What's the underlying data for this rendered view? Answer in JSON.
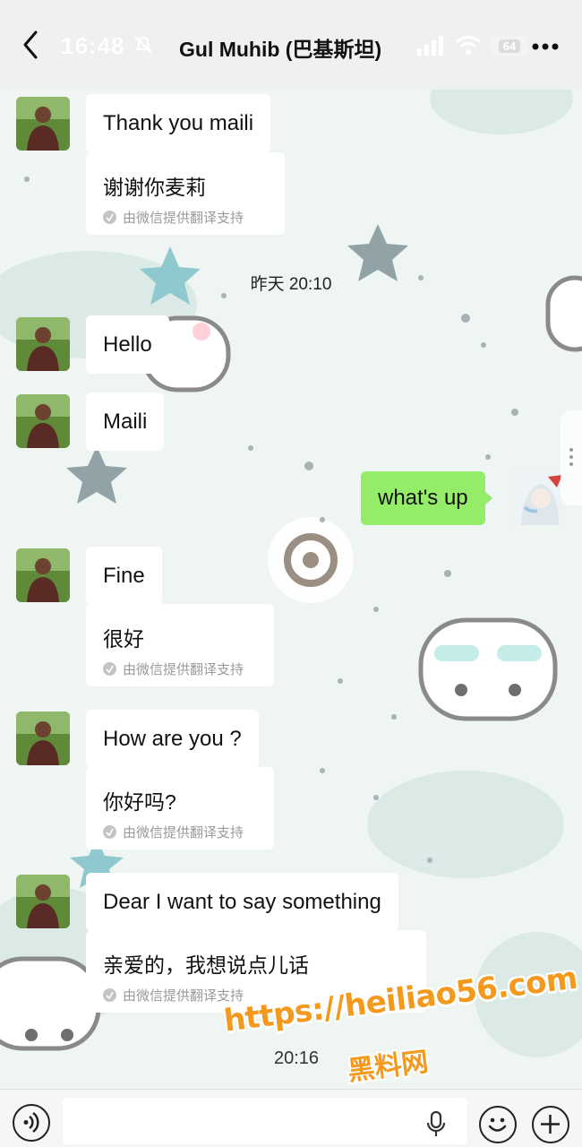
{
  "status_bar": {
    "time": "16:48",
    "battery": "64"
  },
  "header": {
    "title": "Gul Muhib (巴基斯坦)",
    "back_icon": "chevron-left-icon",
    "more_icon": "more-dots-icon"
  },
  "messages": [
    {
      "sender": "contact",
      "text": "Thank you maili",
      "translation": "谢谢你麦莉",
      "translation_source": "由微信提供翻译支持"
    },
    {
      "type": "timestamp",
      "text": "昨天 20:10"
    },
    {
      "sender": "contact",
      "text": "Hello"
    },
    {
      "sender": "contact",
      "text": "Maili"
    },
    {
      "sender": "me",
      "text": "what's up"
    },
    {
      "sender": "contact",
      "text": "Fine",
      "translation": "很好",
      "translation_source": "由微信提供翻译支持"
    },
    {
      "sender": "contact",
      "text": "How are you ?",
      "translation": "你好吗?",
      "translation_source": "由微信提供翻译支持"
    },
    {
      "sender": "contact",
      "text": "Dear I want to say something",
      "translation": "亲爱的，我想说点儿话",
      "translation_source": "由微信提供翻译支持"
    }
  ],
  "partial_timestamp": "20:16",
  "watermark": {
    "url": "https://heiliao56.com",
    "name": "黑料网"
  },
  "input_bar": {
    "voice_icon": "voice-icon",
    "mic_icon": "microphone-icon",
    "emoji_icon": "emoji-icon",
    "plus_icon": "plus-icon"
  },
  "colors": {
    "my_bubble": "#95ec69",
    "their_bubble": "#ffffff",
    "watermark": "#f39a1e"
  }
}
